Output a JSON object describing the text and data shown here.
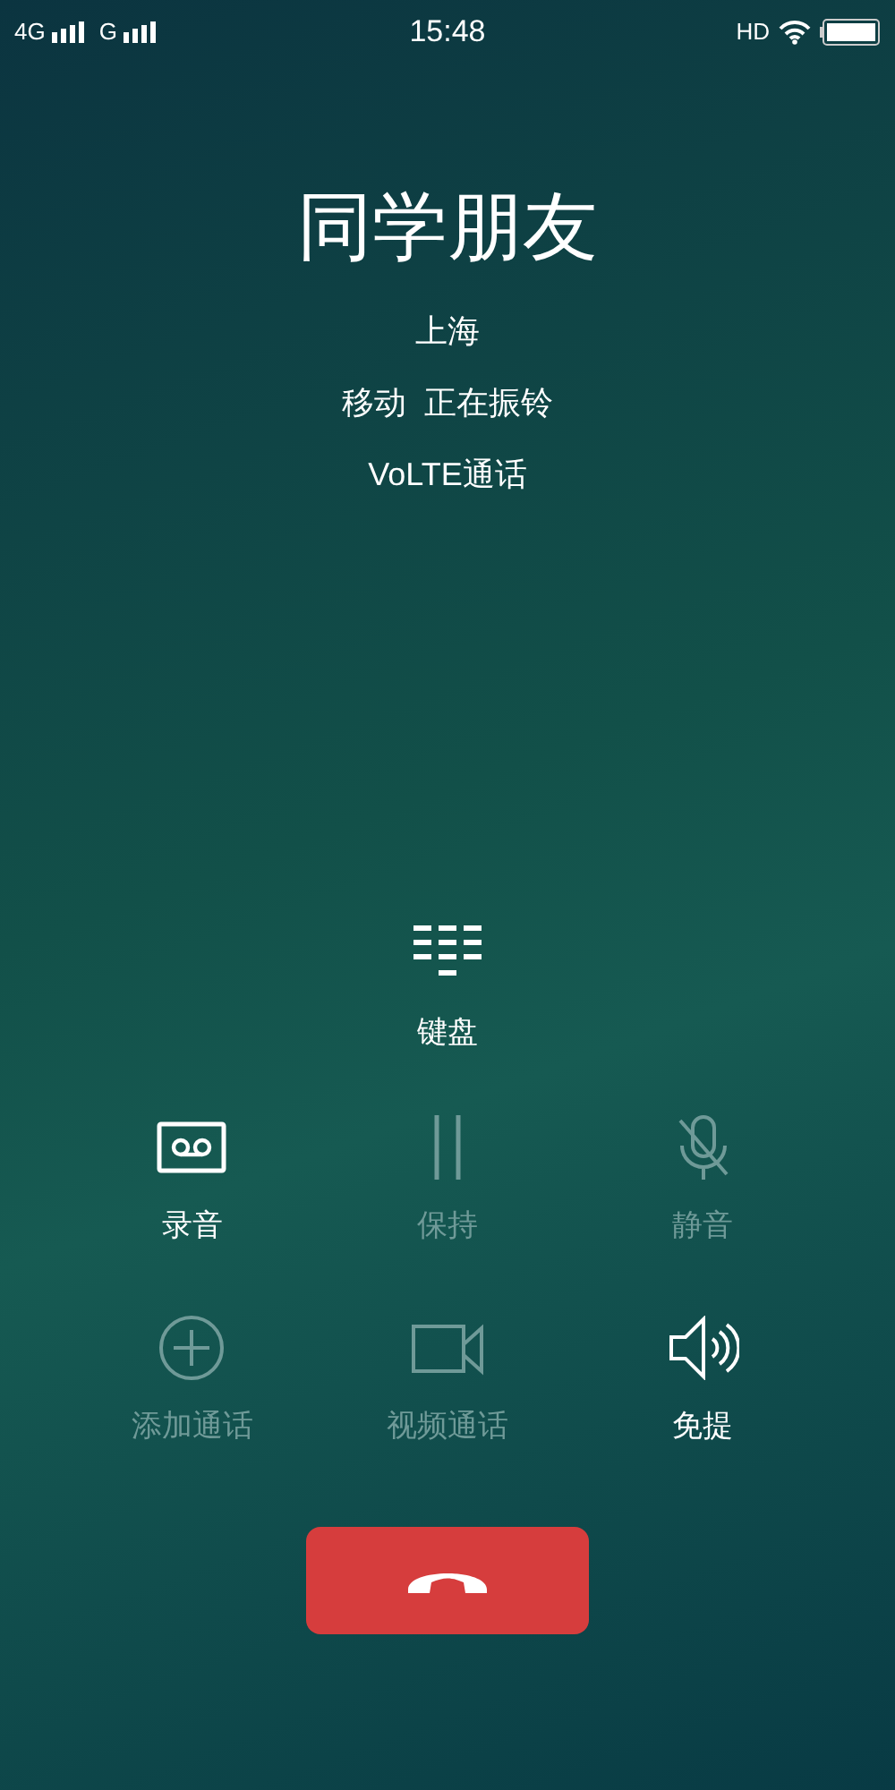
{
  "status_bar": {
    "network_1": "4G",
    "network_2": "G",
    "time": "15:48",
    "hd": "HD"
  },
  "caller": {
    "name": "同学朋友",
    "location": "上海",
    "carrier": "移动",
    "call_state": "正在振铃",
    "call_type": "VoLTE通话"
  },
  "keypad": {
    "label": "键盘"
  },
  "controls": [
    {
      "kind": "record",
      "label": "录音",
      "disabled": false
    },
    {
      "kind": "hold",
      "label": "保持",
      "disabled": true
    },
    {
      "kind": "mute",
      "label": "静音",
      "disabled": true
    },
    {
      "kind": "add",
      "label": "添加通话",
      "disabled": true
    },
    {
      "kind": "video",
      "label": "视频通话",
      "disabled": true
    },
    {
      "kind": "speaker",
      "label": "免提",
      "disabled": false
    }
  ]
}
